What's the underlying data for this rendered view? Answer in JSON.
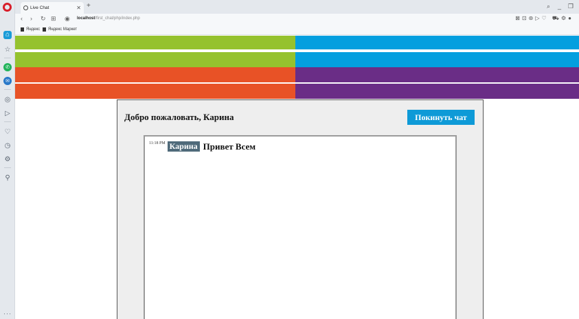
{
  "browser": {
    "tab": {
      "title": "Live Chat",
      "close": "✕"
    },
    "new_tab": "+",
    "url": {
      "host": "localhost",
      "path": "/first_chat/php/index.php"
    },
    "bookmarks": [
      "Яндекс",
      "Яндекс Маркет"
    ]
  },
  "colors": {
    "green": "#95c22e",
    "blue": "#049fdf",
    "orange": "#e85226",
    "purple": "#6a2d86",
    "leave_button": "#0e9ad7",
    "username_badge": "#4f6a7a"
  },
  "chat": {
    "welcome": "Добро пожаловать, Карина",
    "leave_button": "Покинуть чат",
    "messages": [
      {
        "time": "11:18 PM",
        "user": "Карина",
        "text": "Привет Всем"
      }
    ]
  }
}
